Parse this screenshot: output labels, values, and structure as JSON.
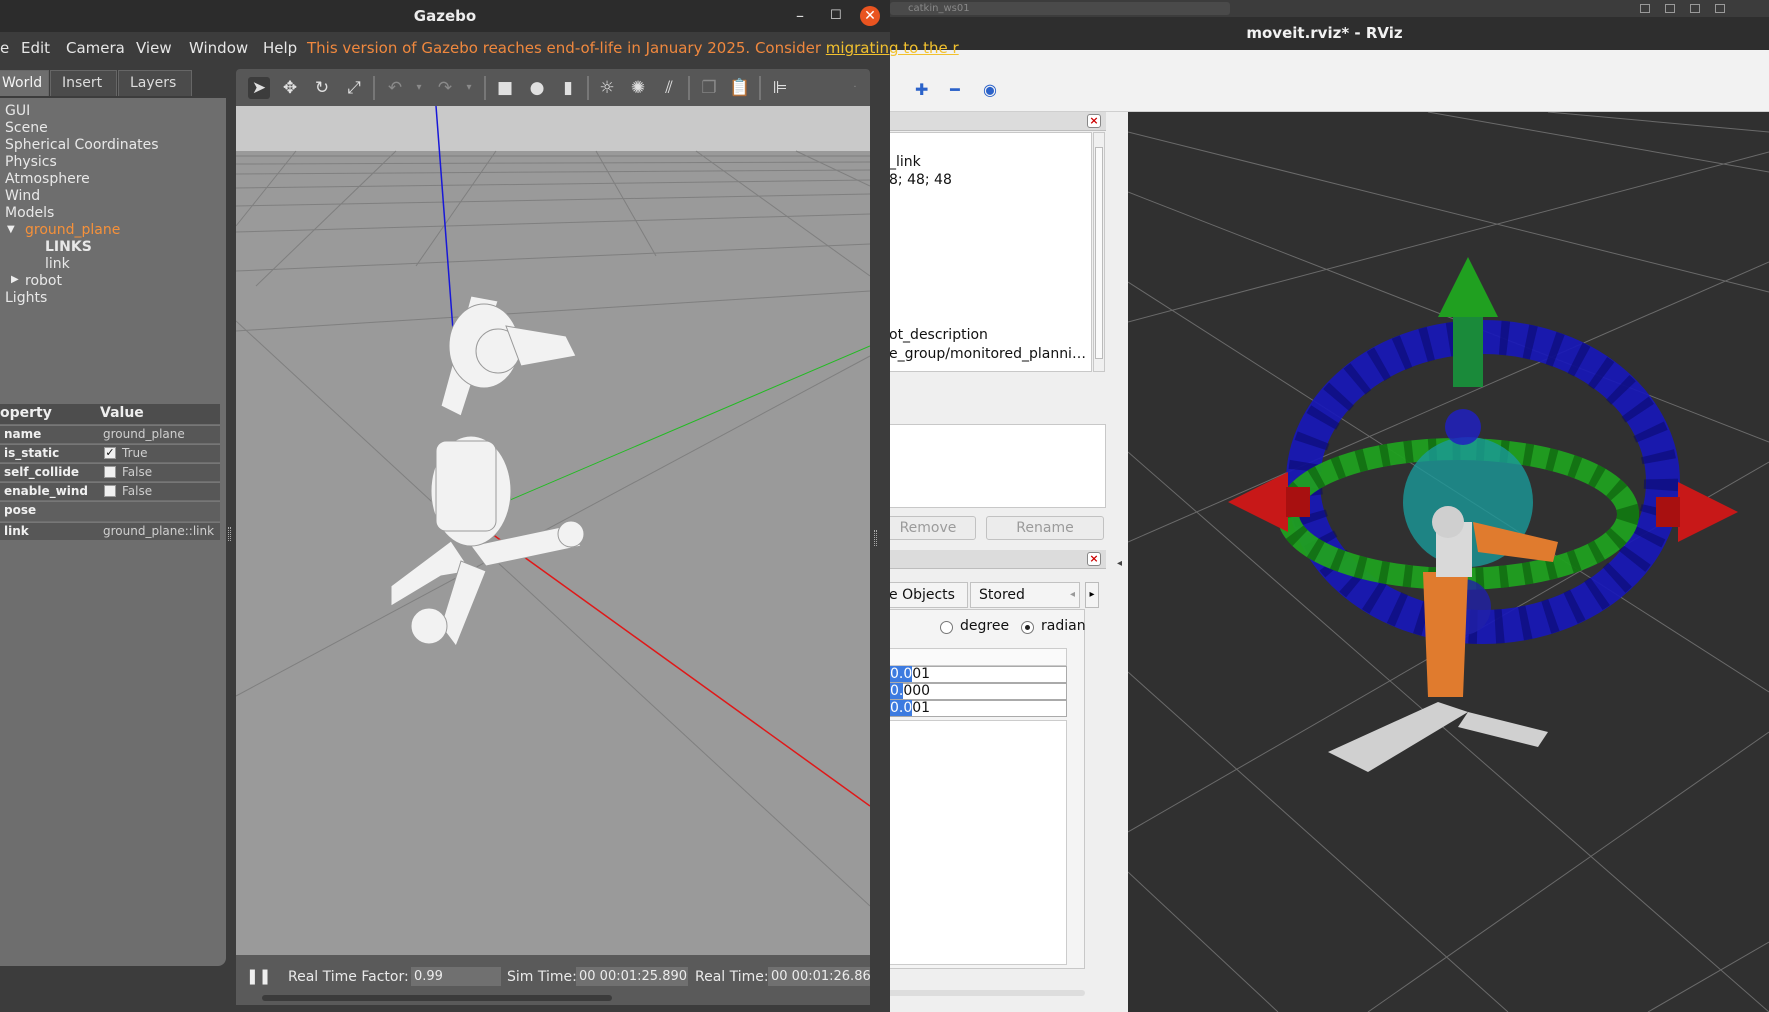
{
  "rviz": {
    "title": "moveit.rviz* - RViz",
    "ghost_tab": "catkin_ws01",
    "props": {
      "line1": "_link",
      "line2": "8; 48; 48",
      "line3": "ot_description",
      "line4": "e_group/monitored_planni…"
    },
    "buttons": {
      "remove": "Remove",
      "rename": "Rename"
    },
    "tabs": {
      "scene_objects": "e Objects",
      "stored_scenes": "Stored Scene"
    },
    "radios": {
      "degree": "degree",
      "radian": "radian",
      "selected": "radian"
    },
    "fields": [
      {
        "sel": "0.0",
        "rest": "01"
      },
      {
        "sel": "0.",
        "rest": "000"
      },
      {
        "sel": "0.0",
        "rest": "01"
      }
    ]
  },
  "gazebo": {
    "title": "Gazebo",
    "menu": [
      "e",
      "Edit",
      "Camera",
      "View",
      "Window",
      "Help"
    ],
    "eol_notice": "This version of Gazebo reaches end-of-life in January 2025. Consider",
    "eol_link": "migrating to the r",
    "tabs": [
      "World",
      "Insert",
      "Layers"
    ],
    "tree": {
      "gui": "GUI",
      "scene": "Scene",
      "spherical": "Spherical Coordinates",
      "physics": "Physics",
      "atmosphere": "Atmosphere",
      "wind": "Wind",
      "models": "Models",
      "ground_plane": "ground_plane",
      "links": "LINKS",
      "link": "link",
      "robot": "robot",
      "lights": "Lights"
    },
    "prop_header": {
      "property": "operty",
      "value": "Value"
    },
    "props": [
      {
        "key": "name",
        "value": "ground_plane",
        "check": null
      },
      {
        "key": "is_static",
        "value": "True",
        "check": true
      },
      {
        "key": "self_collide",
        "value": "False",
        "check": false
      },
      {
        "key": "enable_wind",
        "value": "False",
        "check": false
      },
      {
        "key": "pose",
        "value": "",
        "check": null
      },
      {
        "key": "link",
        "value": "ground_plane::link",
        "check": null
      }
    ],
    "status": {
      "rtf_label": "Real Time Factor:",
      "rtf_value": "0.99",
      "sim_label": "Sim Time:",
      "sim_value": "00 00:01:25.890",
      "real_label": "Real Time:",
      "real_value": "00 00:01:26.86"
    }
  },
  "colors": {
    "accent_orange": "#e95420",
    "selection_orange": "#f6913a",
    "eol_text": "#f0883e",
    "x_axis": "#e01010",
    "y_axis": "#20b020",
    "z_axis": "#1010e0"
  }
}
